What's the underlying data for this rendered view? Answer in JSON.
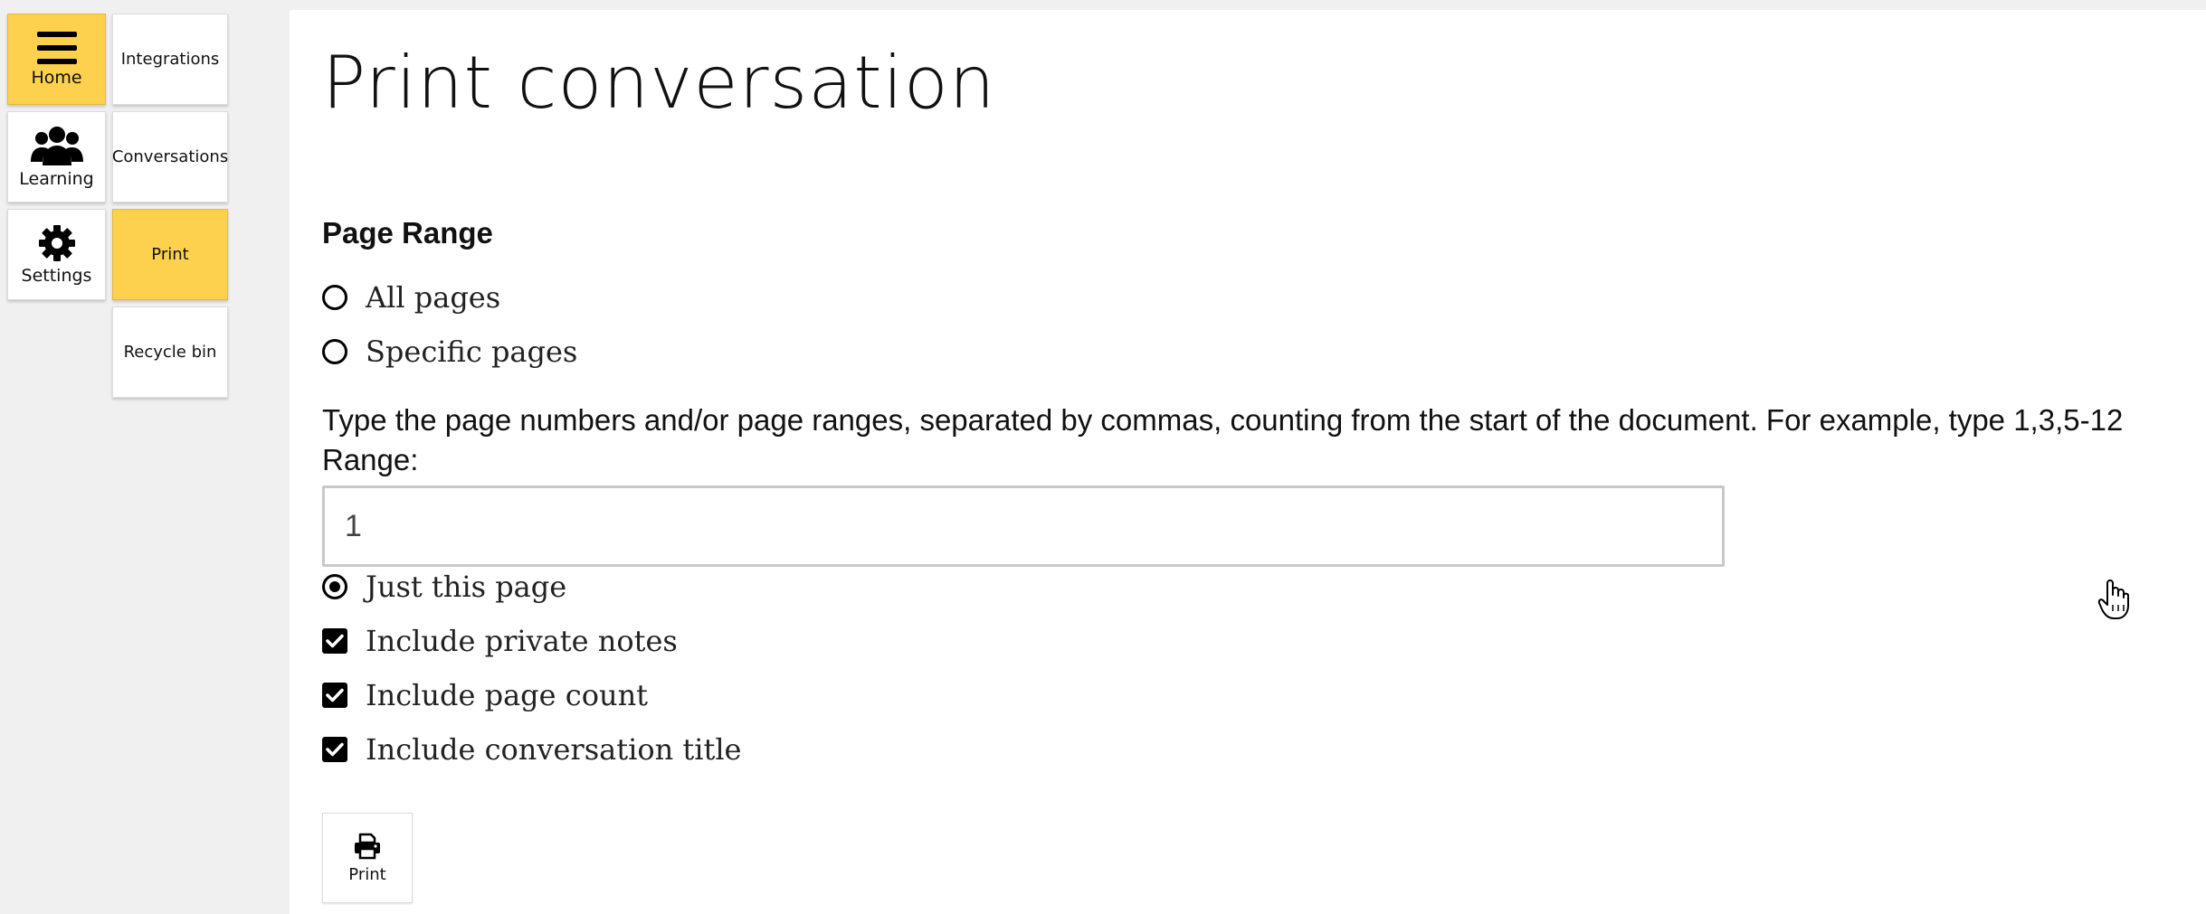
{
  "nav": {
    "primary": [
      {
        "label": "Home",
        "icon": "hamburger-menu-icon",
        "active": true
      },
      {
        "label": "Learning",
        "icon": "users-group-icon",
        "active": false
      },
      {
        "label": "Settings",
        "icon": "gear-icon",
        "active": false
      }
    ],
    "secondary": [
      {
        "label": "Integrations",
        "active": false
      },
      {
        "label": "Conversations",
        "active": false
      },
      {
        "label": "Print",
        "active": true
      },
      {
        "label": "Recycle bin",
        "active": false
      }
    ]
  },
  "main": {
    "title": "Print conversation",
    "page_range_heading": "Page Range",
    "options": {
      "all_pages": {
        "label": "All pages",
        "selected": false
      },
      "specific_pages": {
        "label": "Specific pages",
        "selected": false
      },
      "just_this_page": {
        "label": "Just this page",
        "selected": true
      }
    },
    "help_text": "Type the page numbers and/or page ranges, separated by commas, counting from the start of the document. For example, type 1,3,5-12",
    "range_label": "Range:",
    "range_value": "1",
    "checkboxes": {
      "include_private_notes": {
        "label": "Include private notes",
        "checked": true
      },
      "include_page_count": {
        "label": "Include page count",
        "checked": true
      },
      "include_conversation_title": {
        "label": "Include conversation title",
        "checked": true
      }
    },
    "print_button": {
      "label": "Print",
      "icon": "printer-icon"
    }
  },
  "colors": {
    "accent": "#fdd14d",
    "panel_background": "#ffffff",
    "app_background": "#f0f0f0",
    "input_border": "#c8c8c8"
  }
}
